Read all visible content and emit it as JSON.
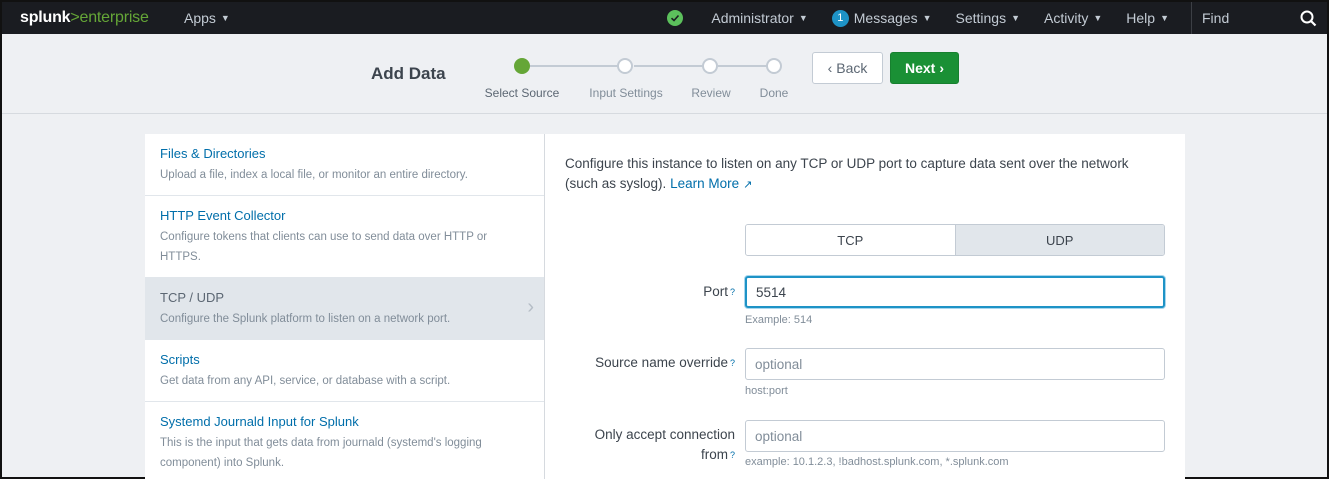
{
  "topbar": {
    "logo_main": "splunk",
    "logo_sep": ">",
    "logo_sub": "enterprise",
    "apps": "Apps",
    "user": "Administrator",
    "messages_count": "1",
    "messages": "Messages",
    "settings": "Settings",
    "activity": "Activity",
    "help": "Help",
    "find_placeholder": "Find"
  },
  "header": {
    "title": "Add Data",
    "steps": [
      "Select Source",
      "Input Settings",
      "Review",
      "Done"
    ],
    "back": "Back",
    "next": "Next"
  },
  "sources": [
    {
      "title": "Files & Directories",
      "desc": "Upload a file, index a local file, or monitor an entire directory."
    },
    {
      "title": "HTTP Event Collector",
      "desc": "Configure tokens that clients can use to send data over HTTP or HTTPS."
    },
    {
      "title": "TCP / UDP",
      "desc": "Configure the Splunk platform to listen on a network port."
    },
    {
      "title": "Scripts",
      "desc": "Get data from any API, service, or database with a script."
    },
    {
      "title": "Systemd Journald Input for Splunk",
      "desc": "This is the input that gets data from journald (systemd's logging component) into Splunk."
    }
  ],
  "form": {
    "intro": "Configure this instance to listen on any TCP or UDP port to capture data sent over the network (such as syslog).",
    "learn_more": "Learn More",
    "tcp": "TCP",
    "udp": "UDP",
    "port_label": "Port",
    "port_value": "5514",
    "port_help": "Example: 514",
    "source_label": "Source name override",
    "source_placeholder": "optional",
    "source_help": "host:port",
    "accept_label": "Only accept connection from",
    "accept_placeholder": "optional",
    "accept_help": "example: 10.1.2.3, !badhost.splunk.com, *.splunk.com",
    "help_mark": "?"
  }
}
